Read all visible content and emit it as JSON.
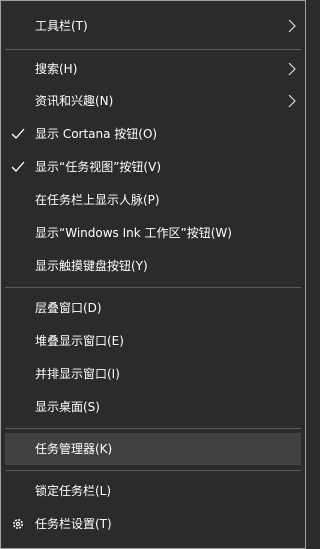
{
  "colors": {
    "background": "#2b2b2b",
    "highlight": "#414141",
    "separator": "#5a5a5a",
    "text": "#ffffff"
  },
  "menu": {
    "toolbars": "工具栏(T)",
    "search": "搜索(H)",
    "news": "资讯和兴趣(N)",
    "cortana": "显示 Cortana 按钮(O)",
    "task_view": "显示“任务视图”按钮(V)",
    "people": "在任务栏上显示人脉(P)",
    "ink": "显示“Windows Ink 工作区”按钮(W)",
    "touch_keyboard": "显示触摸键盘按钮(Y)",
    "cascade": "层叠窗口(D)",
    "stacked": "堆叠显示窗口(E)",
    "side_by_side": "并排显示窗口(I)",
    "desktop": "显示桌面(S)",
    "task_manager": "任务管理器(K)",
    "lock": "锁定任务栏(L)",
    "settings": "任务栏设置(T)"
  },
  "icons": {
    "submenu": "chevron-right-icon",
    "checked": "checkmark-icon",
    "settings": "gear-icon"
  },
  "state": {
    "cortana_checked": true,
    "task_view_checked": true,
    "hovered_item": "任务管理器(K)"
  }
}
